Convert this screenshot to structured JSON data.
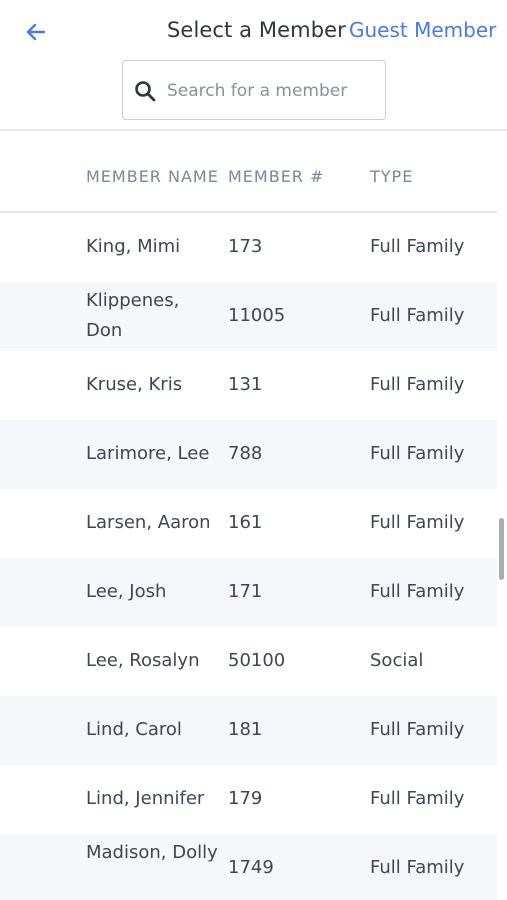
{
  "header": {
    "title": "Select a Member",
    "guest_link": "Guest Member",
    "back_icon": "arrow-left-icon"
  },
  "search": {
    "placeholder": "Search for a member",
    "value": "",
    "icon": "search-icon"
  },
  "table": {
    "columns": [
      "MEMBER NAME",
      "MEMBER #",
      "TYPE"
    ],
    "rows": [
      {
        "name": "King, Mimi",
        "number": "173",
        "type": "Full Family"
      },
      {
        "name": "Klippenes, Don",
        "number": "11005",
        "type": "Full Family"
      },
      {
        "name": "Kruse, Kris",
        "number": "131",
        "type": "Full Family"
      },
      {
        "name": "Larimore, Lee",
        "number": "788",
        "type": "Full Family"
      },
      {
        "name": "Larsen, Aaron",
        "number": "161",
        "type": "Full Family"
      },
      {
        "name": "Lee, Josh",
        "number": "171",
        "type": "Full Family"
      },
      {
        "name": "Lee, Rosalyn",
        "number": "50100",
        "type": "Social"
      },
      {
        "name": "Lind, Carol",
        "number": "181",
        "type": "Full Family"
      },
      {
        "name": "Lind, Jennifer",
        "number": "179",
        "type": "Full Family"
      },
      {
        "name": "Madison, Dolly",
        "number": "1749",
        "type": "Full Family"
      }
    ]
  },
  "colors": {
    "accent": "#4a7be0",
    "row_alt": "#f5f7fa",
    "header_text": "#7b8696"
  }
}
